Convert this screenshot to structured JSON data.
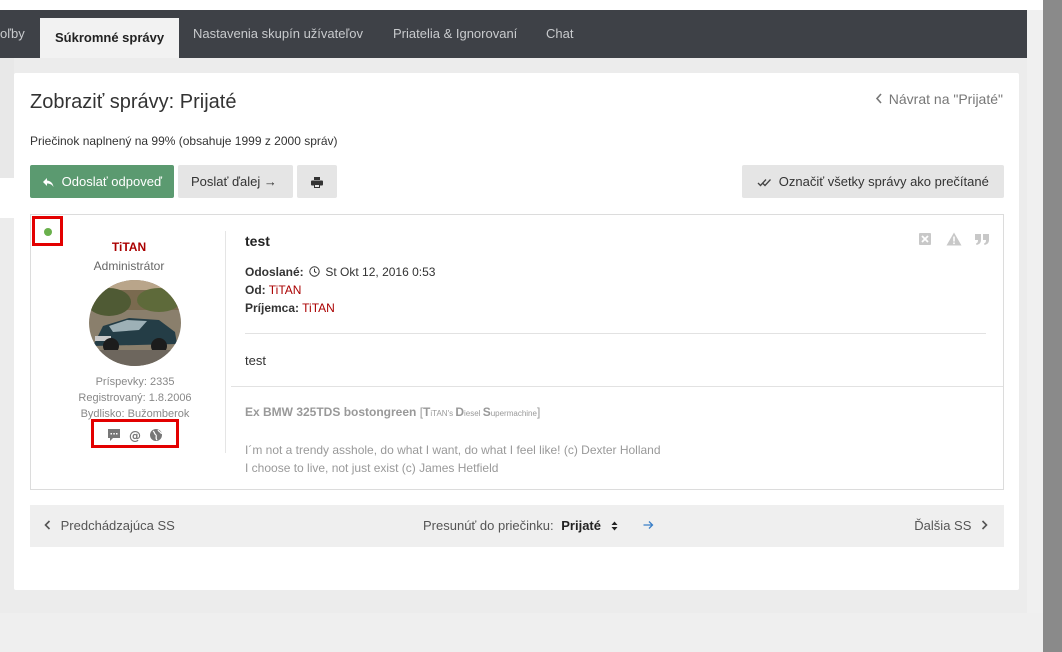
{
  "tabs": [
    {
      "label": "oľby"
    },
    {
      "label": "Súkromné správy"
    },
    {
      "label": "Nastavenia skupín užívateľov"
    },
    {
      "label": "Priatelia & Ignorovaní"
    },
    {
      "label": "Chat"
    }
  ],
  "page": {
    "title": "Zobraziť správy: Prijaté",
    "back_link": "Návrat na \"Prijaté\"",
    "folder_info": "Priečinok naplnený na 99% (obsahuje 1999 z 2000 správ)"
  },
  "toolbar": {
    "reply_label": "Odoslať odpoveď",
    "forward_label": "Poslať ďalej →",
    "markall_label": "Označiť všetky správy ako prečítané"
  },
  "author": {
    "name": "TiTAN",
    "rank": "Administrátor",
    "posts": "Príspevky: 2335",
    "registered": "Registrovaný: 1.8.2006",
    "location": "Bydlisko: Bužomberok"
  },
  "message": {
    "subject": "test",
    "sent_label": "Odoslané:",
    "sent_value": "St Okt 12, 2016 0:53",
    "from_label": "Od:",
    "from_value": "TiTAN",
    "to_label": "Príjemca:",
    "to_value": "TiTAN",
    "content": "test"
  },
  "signature": {
    "title": "Ex BMW 325TDS bostongreen",
    "bracket_open": "[",
    "t1": "T",
    "t1s": "iTAN's ",
    "t2": "D",
    "t2s": "iesel ",
    "t3": "S",
    "t3s": "upermachine",
    "bracket_close": "]",
    "quote1": "I´m not a trendy asshole, do what I want, do what I feel like! (c) Dexter Holland",
    "quote2": "I choose to live, not just exist (c) James Hetfield"
  },
  "pager": {
    "prev": "Predchádzajúca SS",
    "move_label": "Presunúť do priečinku:",
    "move_value": "Prijaté",
    "next": "Ďalšia SS"
  },
  "colors": {
    "accent_green": "#5b9a70",
    "username_red": "#aa0000",
    "highlight_red": "#e30000",
    "tabbar": "#3e4147",
    "online": "#6ab04c"
  },
  "icons": [
    "reply-icon",
    "print-icon",
    "double-check-icon",
    "clock-icon",
    "delete-icon",
    "warning-icon",
    "quote-icon",
    "pm-icon",
    "email-icon",
    "website-icon",
    "chevron-left-icon",
    "chevron-right-icon",
    "arrow-right-icon",
    "select-arrows-icon"
  ]
}
